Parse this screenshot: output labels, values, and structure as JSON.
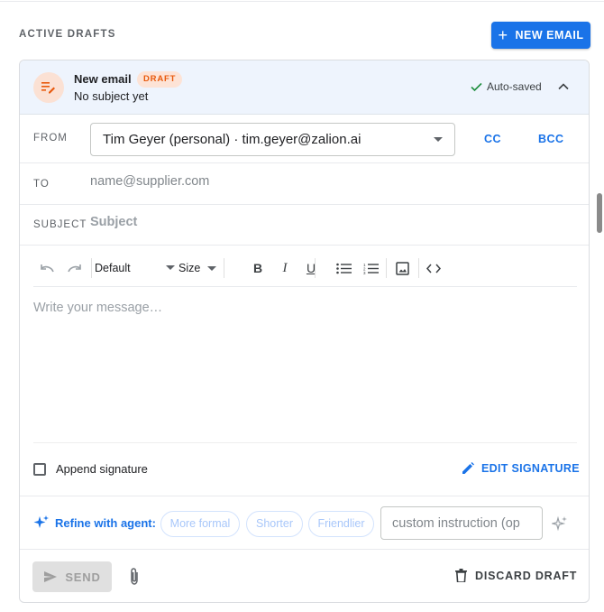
{
  "section": {
    "title": "ACTIVE DRAFTS"
  },
  "toolbar_top": {
    "new_email_label": "NEW EMAIL",
    "accent": "#1a73e8"
  },
  "draft": {
    "title": "New email",
    "badge": "DRAFT",
    "subtitle": "No subject yet",
    "status": "Auto-saved",
    "icon": "draft-edit-icon",
    "badge_color": "#e8590c"
  },
  "from": {
    "label": "FROM",
    "selected": "Tim Geyer (personal) · tim.geyer@zalion.ai",
    "cc_label": "CC",
    "bcc_label": "BCC"
  },
  "to": {
    "label": "TO",
    "placeholder": "name@supplier.com",
    "value": ""
  },
  "subject": {
    "label": "SUBJECT",
    "placeholder": "Subject",
    "value": ""
  },
  "editor_toolbar": {
    "font_family": "Default",
    "font_size": "Size",
    "icons": [
      "undo-icon",
      "redo-icon",
      "bold-icon",
      "italic-icon",
      "underline-icon",
      "bulleted-list-icon",
      "numbered-list-icon",
      "image-icon",
      "code-icon"
    ]
  },
  "editor": {
    "placeholder": "Write your message…"
  },
  "signature": {
    "append_label": "Append signature",
    "checked": false,
    "edit_label": "EDIT SIGNATURE"
  },
  "refine": {
    "label": "Refine with agent:",
    "chips": [
      "More formal",
      "Shorter",
      "Friendlier"
    ],
    "custom_placeholder": "custom instruction (op"
  },
  "footer": {
    "send_label": "SEND",
    "discard_label": "DISCARD DRAFT",
    "send_enabled": false
  }
}
